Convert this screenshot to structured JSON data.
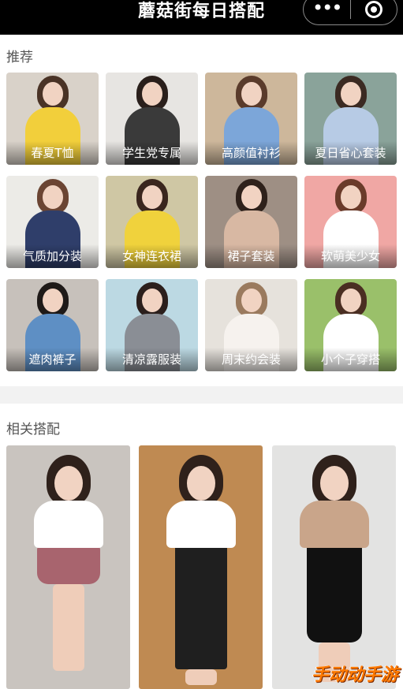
{
  "header": {
    "title": "蘑菇街每日搭配"
  },
  "icons": {
    "more": "more-dots-icon",
    "close": "mini-program-close-icon"
  },
  "recommend": {
    "title": "推荐",
    "items": [
      {
        "label": "春夏T恤",
        "bg": "#d9d2c9",
        "top": "#f2cf3b",
        "hair": "#4a3326"
      },
      {
        "label": "学生党专属",
        "bg": "#e7e5e2",
        "top": "#3a3a3a",
        "hair": "#2a1f1b"
      },
      {
        "label": "高颜值衬衫",
        "bg": "#cdb79b",
        "top": "#7ca6d9",
        "hair": "#5a3b2b"
      },
      {
        "label": "夏日省心套装",
        "bg": "#8aa39a",
        "top": "#b7cbe5",
        "hair": "#3b2a22"
      },
      {
        "label": "气质加分装",
        "bg": "#ecebe7",
        "top": "#2f3e6a",
        "hair": "#6b4533"
      },
      {
        "label": "女神连衣裙",
        "bg": "#cfc7a4",
        "top": "#f0d23c",
        "hair": "#3a261e"
      },
      {
        "label": "裙子套装",
        "bg": "#9e8f84",
        "top": "#d8b8a3",
        "hair": "#2e211b"
      },
      {
        "label": "软萌美少女",
        "bg": "#f0a7a4",
        "top": "#ffffff",
        "hair": "#6a3b2a"
      },
      {
        "label": "遮肉裤子",
        "bg": "#c7c1bb",
        "top": "#5e8fc4",
        "hair": "#1f1a18"
      },
      {
        "label": "清凉露服装",
        "bg": "#bcd9e3",
        "top": "#8a8e95",
        "hair": "#2b1f1c"
      },
      {
        "label": "周末约会装",
        "bg": "#e6e2dc",
        "top": "#f6f2ee",
        "hair": "#9a7a5e"
      },
      {
        "label": "小个子穿搭",
        "bg": "#9ac06a",
        "top": "#ffffff",
        "hair": "#4a2e22"
      }
    ]
  },
  "related": {
    "title": "相关搭配",
    "items": [
      {
        "name": "outfit-red-beret-plaid-skirt",
        "bg": "#c9c4bf",
        "top": "#ffffff",
        "bottom": "#a8646e"
      },
      {
        "name": "outfit-white-tee-polka-pants",
        "bg": "#bf8a52",
        "top": "#ffffff",
        "bottom": "#1f1f1f"
      },
      {
        "name": "outfit-beige-tee-black-slip-dress",
        "bg": "#e3e3e2",
        "top": "#c9a58a",
        "bottom": "#111111"
      }
    ]
  },
  "watermark": {
    "text": "手动动手游"
  }
}
